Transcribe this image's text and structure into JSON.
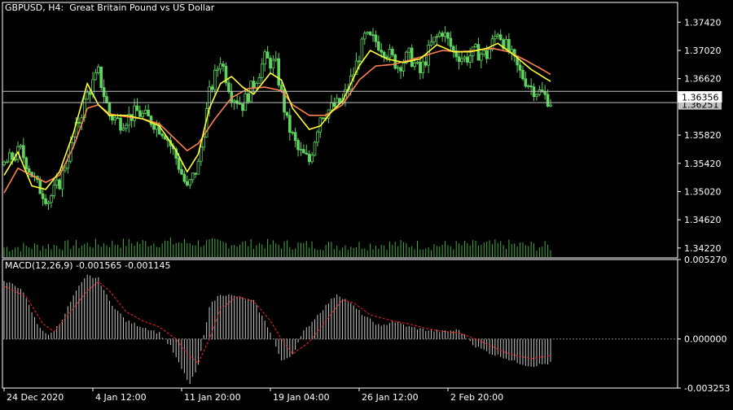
{
  "window": {
    "symbol": "GBPUSD, H4:",
    "description": "Great Britain Pound vs US Dollar"
  },
  "colors": {
    "background": "#000000",
    "frame": "#ffffff",
    "candle": "#5fd35f",
    "volume": "#3fae3f",
    "ma_fast": "#ffff33",
    "ma_slow": "#ff7f50",
    "macd_hist": "#c8c8c8",
    "macd_signal": "#ff2020",
    "zero_line": "#808080",
    "hline": "#c0c0c0"
  },
  "chart_data": [
    {
      "type": "line",
      "panel": "price",
      "title": "GBPUSD, H4:  Great Britain Pound vs US Dollar",
      "ylim": [
        1.3408,
        1.377
      ],
      "y_ticks": [
        "1.37420",
        "1.37020",
        "1.36620",
        "1.35820",
        "1.35420",
        "1.35020",
        "1.34620",
        "1.34220"
      ],
      "current_price": "1.36356",
      "hidden_price_label": "1.36251",
      "hlines": [
        1.3644,
        1.3628
      ],
      "x_ticks": [
        "24 Dec 2020",
        "4 Jan 12:00",
        "11 Jan 20:00",
        "19 Jan 04:00",
        "26 Jan 12:00",
        "2 Feb 20:00"
      ],
      "price_anchors": [
        [
          0,
          1.354
        ],
        [
          6,
          1.356
        ],
        [
          12,
          1.351
        ],
        [
          16,
          1.349
        ],
        [
          20,
          1.3515
        ],
        [
          26,
          1.359
        ],
        [
          30,
          1.364
        ],
        [
          34,
          1.367
        ],
        [
          38,
          1.361
        ],
        [
          42,
          1.36
        ],
        [
          48,
          1.3615
        ],
        [
          54,
          1.36
        ],
        [
          58,
          1.3585
        ],
        [
          62,
          1.355
        ],
        [
          66,
          1.3505
        ],
        [
          70,
          1.354
        ],
        [
          74,
          1.364
        ],
        [
          78,
          1.369
        ],
        [
          82,
          1.364
        ],
        [
          86,
          1.3625
        ],
        [
          90,
          1.3655
        ],
        [
          94,
          1.369
        ],
        [
          98,
          1.368
        ],
        [
          102,
          1.36
        ],
        [
          106,
          1.356
        ],
        [
          110,
          1.3545
        ],
        [
          114,
          1.361
        ],
        [
          118,
          1.362
        ],
        [
          122,
          1.363
        ],
        [
          126,
          1.367
        ],
        [
          130,
          1.372
        ],
        [
          134,
          1.3715
        ],
        [
          138,
          1.37
        ],
        [
          142,
          1.368
        ],
        [
          146,
          1.3695
        ],
        [
          150,
          1.367
        ],
        [
          154,
          1.371
        ],
        [
          158,
          1.373
        ],
        [
          162,
          1.37
        ],
        [
          166,
          1.369
        ],
        [
          170,
          1.37
        ],
        [
          174,
          1.3695
        ],
        [
          178,
          1.373
        ],
        [
          182,
          1.37
        ],
        [
          186,
          1.367
        ],
        [
          190,
          1.365
        ],
        [
          194,
          1.364
        ],
        [
          197,
          1.363
        ]
      ],
      "ma_fast_anchors": [
        [
          0,
          1.3525
        ],
        [
          5,
          1.3558
        ],
        [
          10,
          1.351
        ],
        [
          15,
          1.3505
        ],
        [
          20,
          1.353
        ],
        [
          25,
          1.3585
        ],
        [
          30,
          1.3655
        ],
        [
          34,
          1.3625
        ],
        [
          38,
          1.361
        ],
        [
          44,
          1.361
        ],
        [
          50,
          1.3605
        ],
        [
          56,
          1.3595
        ],
        [
          62,
          1.356
        ],
        [
          66,
          1.353
        ],
        [
          70,
          1.3555
        ],
        [
          74,
          1.362
        ],
        [
          78,
          1.3655
        ],
        [
          82,
          1.3665
        ],
        [
          86,
          1.365
        ],
        [
          90,
          1.364
        ],
        [
          96,
          1.367
        ],
        [
          100,
          1.366
        ],
        [
          104,
          1.362
        ],
        [
          110,
          1.359
        ],
        [
          114,
          1.3595
        ],
        [
          118,
          1.3615
        ],
        [
          122,
          1.363
        ],
        [
          128,
          1.368
        ],
        [
          132,
          1.3702
        ],
        [
          138,
          1.369
        ],
        [
          144,
          1.3685
        ],
        [
          150,
          1.369
        ],
        [
          156,
          1.371
        ],
        [
          162,
          1.37
        ],
        [
          168,
          1.37
        ],
        [
          174,
          1.3705
        ],
        [
          178,
          1.3712
        ],
        [
          184,
          1.3695
        ],
        [
          190,
          1.3675
        ],
        [
          197,
          1.3658
        ]
      ],
      "ma_slow_anchors": [
        [
          0,
          1.35
        ],
        [
          5,
          1.3535
        ],
        [
          10,
          1.3525
        ],
        [
          15,
          1.3515
        ],
        [
          20,
          1.3525
        ],
        [
          25,
          1.3565
        ],
        [
          30,
          1.362
        ],
        [
          34,
          1.3625
        ],
        [
          38,
          1.3612
        ],
        [
          44,
          1.3608
        ],
        [
          50,
          1.3605
        ],
        [
          56,
          1.3598
        ],
        [
          62,
          1.3575
        ],
        [
          66,
          1.356
        ],
        [
          70,
          1.357
        ],
        [
          76,
          1.3605
        ],
        [
          82,
          1.3635
        ],
        [
          88,
          1.3648
        ],
        [
          94,
          1.365
        ],
        [
          100,
          1.3645
        ],
        [
          104,
          1.3625
        ],
        [
          110,
          1.361
        ],
        [
          116,
          1.361
        ],
        [
          122,
          1.3625
        ],
        [
          128,
          1.366
        ],
        [
          134,
          1.368
        ],
        [
          140,
          1.3682
        ],
        [
          146,
          1.3688
        ],
        [
          152,
          1.3695
        ],
        [
          158,
          1.3702
        ],
        [
          164,
          1.37
        ],
        [
          170,
          1.3702
        ],
        [
          176,
          1.3705
        ],
        [
          182,
          1.37
        ],
        [
          188,
          1.3688
        ],
        [
          194,
          1.3675
        ],
        [
          197,
          1.3668
        ]
      ],
      "volume_anchors": [
        [
          0,
          0.45
        ],
        [
          20,
          0.55
        ],
        [
          40,
          0.65
        ],
        [
          60,
          0.7
        ],
        [
          80,
          0.65
        ],
        [
          100,
          0.6
        ],
        [
          120,
          0.55
        ],
        [
          140,
          0.6
        ],
        [
          160,
          0.55
        ],
        [
          180,
          0.6
        ],
        [
          197,
          0.5
        ]
      ]
    },
    {
      "type": "bar",
      "panel": "macd",
      "title": "MACD(12,26,9) -0.001565 -0.001145",
      "ylim": [
        -0.003253,
        0.00527
      ],
      "y_ticks": [
        "0.005270",
        "0.000000",
        "-0.003253"
      ],
      "hist_anchors": [
        [
          0,
          0.0038
        ],
        [
          6,
          0.0034
        ],
        [
          12,
          0.001
        ],
        [
          16,
          0.0002
        ],
        [
          20,
          0.001
        ],
        [
          26,
          0.0032
        ],
        [
          30,
          0.0042
        ],
        [
          34,
          0.004
        ],
        [
          38,
          0.0025
        ],
        [
          44,
          0.0012
        ],
        [
          50,
          0.0008
        ],
        [
          56,
          0.0004
        ],
        [
          60,
          -0.0005
        ],
        [
          64,
          -0.002
        ],
        [
          67,
          -0.003
        ],
        [
          70,
          -0.0018
        ],
        [
          74,
          0.0022
        ],
        [
          78,
          0.003
        ],
        [
          84,
          0.0028
        ],
        [
          90,
          0.0025
        ],
        [
          96,
          0.0005
        ],
        [
          100,
          -0.0015
        ],
        [
          104,
          -0.001
        ],
        [
          108,
          0.0005
        ],
        [
          114,
          0.0018
        ],
        [
          120,
          0.003
        ],
        [
          124,
          0.0025
        ],
        [
          130,
          0.0015
        ],
        [
          136,
          0.0008
        ],
        [
          140,
          0.0012
        ],
        [
          146,
          0.0008
        ],
        [
          152,
          0.0006
        ],
        [
          158,
          0.0005
        ],
        [
          164,
          0.0006
        ],
        [
          170,
          -0.0005
        ],
        [
          176,
          -0.001
        ],
        [
          180,
          -0.0012
        ],
        [
          184,
          -0.0015
        ],
        [
          190,
          -0.0018
        ],
        [
          197,
          -0.0016
        ]
      ],
      "signal_anchors": [
        [
          0,
          0.0035
        ],
        [
          8,
          0.0028
        ],
        [
          14,
          0.001
        ],
        [
          18,
          0.0005
        ],
        [
          24,
          0.0018
        ],
        [
          30,
          0.0032
        ],
        [
          34,
          0.0038
        ],
        [
          38,
          0.0032
        ],
        [
          44,
          0.0018
        ],
        [
          50,
          0.0012
        ],
        [
          56,
          0.0008
        ],
        [
          62,
          0.0
        ],
        [
          66,
          -0.001
        ],
        [
          70,
          -0.0016
        ],
        [
          74,
          0.0
        ],
        [
          78,
          0.002
        ],
        [
          84,
          0.0028
        ],
        [
          90,
          0.0025
        ],
        [
          96,
          0.0012
        ],
        [
          100,
          0.0
        ],
        [
          104,
          -0.001
        ],
        [
          110,
          -0.0002
        ],
        [
          116,
          0.0012
        ],
        [
          122,
          0.0026
        ],
        [
          126,
          0.0024
        ],
        [
          132,
          0.0016
        ],
        [
          140,
          0.0012
        ],
        [
          146,
          0.001
        ],
        [
          152,
          0.0007
        ],
        [
          158,
          0.0005
        ],
        [
          164,
          0.0004
        ],
        [
          170,
          0.0
        ],
        [
          176,
          -0.0005
        ],
        [
          182,
          -0.001
        ],
        [
          190,
          -0.0013
        ],
        [
          197,
          -0.0011
        ]
      ]
    }
  ]
}
